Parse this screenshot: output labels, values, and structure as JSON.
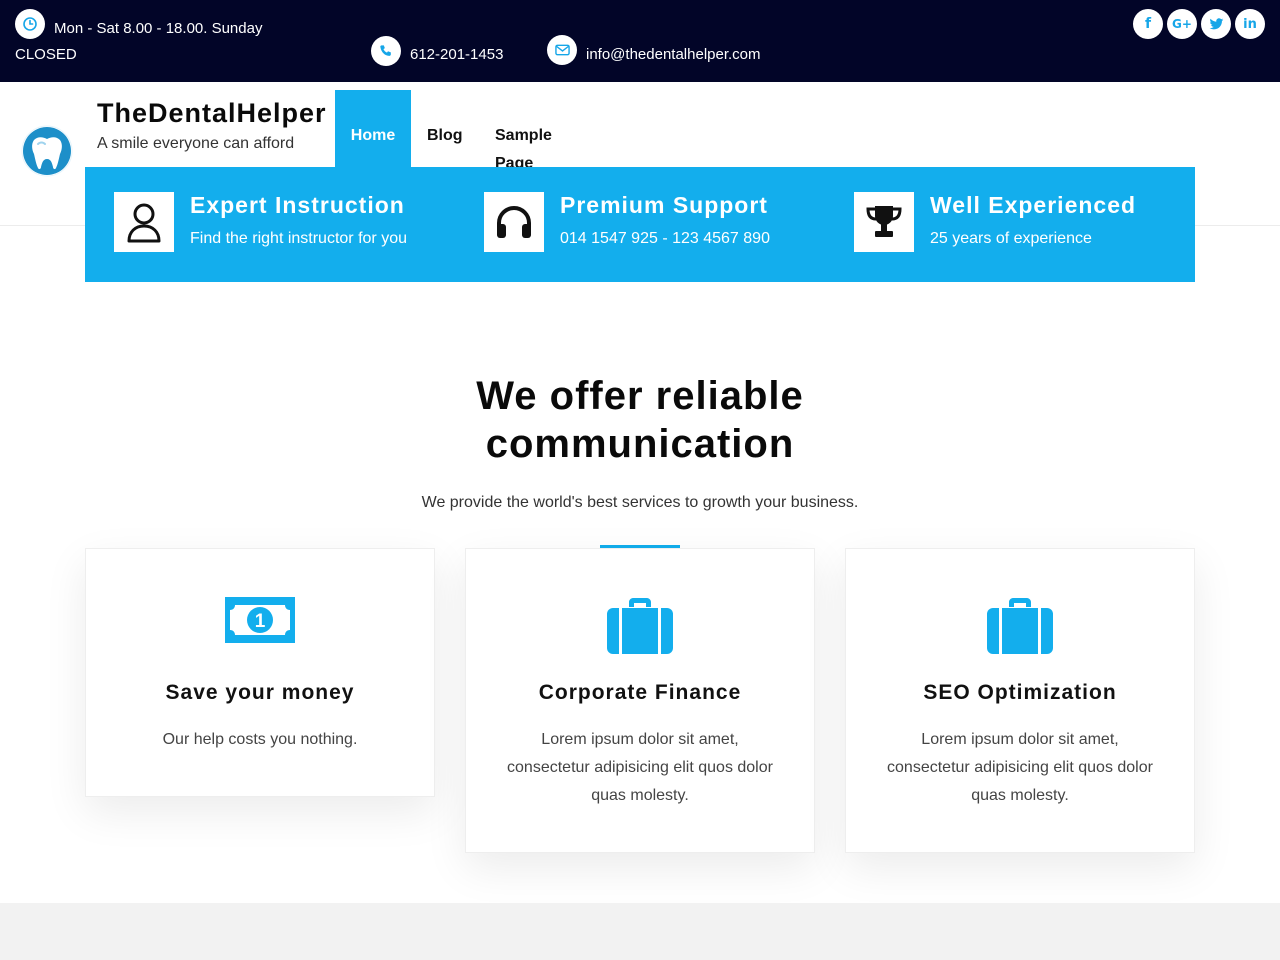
{
  "topbar": {
    "hours": "Mon - Sat 8.00 - 18.00. Sunday",
    "hours_line2": "CLOSED",
    "phone": "612-201-1453",
    "email": "info@thedentalhelper.com",
    "social": [
      {
        "icon": "facebook-icon",
        "glyph": "f"
      },
      {
        "icon": "google-plus-icon",
        "glyph": "G+"
      },
      {
        "icon": "twitter-icon",
        "glyph": "t"
      },
      {
        "icon": "linkedin-icon",
        "glyph": "in"
      }
    ]
  },
  "header": {
    "site_title": "TheDentalHelper",
    "tagline": "A smile everyone can afford",
    "nav": {
      "home": "Home",
      "blog": "Blog",
      "sample_line1": "Sample",
      "sample_line2": "Page"
    }
  },
  "features": [
    {
      "icon": "user-icon",
      "title": "Expert Instruction",
      "desc": "Find the right instructor for you"
    },
    {
      "icon": "headphones-icon",
      "title": "Premium Support",
      "desc": "014 1547 925 - 123 4567 890"
    },
    {
      "icon": "trophy-icon",
      "title": "Well Experienced",
      "desc": "25 years of experience"
    }
  ],
  "section": {
    "title_line1": "We offer reliable",
    "title_line2": "communication",
    "subtitle": "We provide the world's best services to growth your business."
  },
  "cards": [
    {
      "icon": "money-icon",
      "title": "Save your money",
      "desc": "Our help costs you nothing."
    },
    {
      "icon": "briefcase-icon",
      "title": "Corporate Finance",
      "desc": "Lorem ipsum dolor sit amet, consectetur adipisicing elit quos dolor quas molesty."
    },
    {
      "icon": "briefcase-icon",
      "title": "SEO Optimization",
      "desc": "Lorem ipsum dolor sit amet, consectetur adipisicing elit quos dolor quas molesty."
    }
  ],
  "colors": {
    "topbar_bg": "#020528",
    "accent": "#13aeed",
    "text_dark": "#0a0a0a"
  }
}
